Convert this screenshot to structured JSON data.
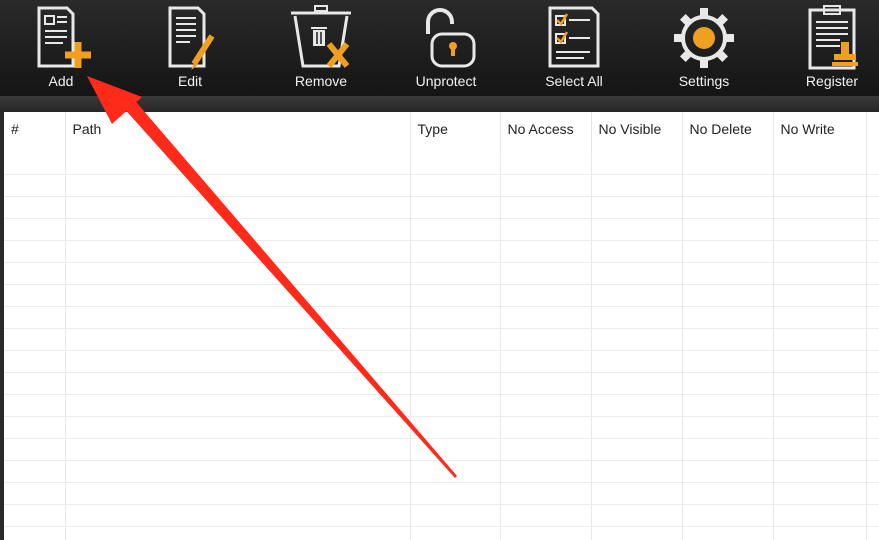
{
  "toolbar": {
    "buttons": [
      {
        "id": "add",
        "label": "Add",
        "icon": "add-document-icon"
      },
      {
        "id": "edit",
        "label": "Edit",
        "icon": "edit-document-icon"
      },
      {
        "id": "remove",
        "label": "Remove",
        "icon": "trash-remove-icon"
      },
      {
        "id": "unprotect",
        "label": "Unprotect",
        "icon": "unlock-icon"
      },
      {
        "id": "select_all",
        "label": "Select All",
        "icon": "checklist-icon"
      },
      {
        "id": "settings",
        "label": "Settings",
        "icon": "gear-icon"
      },
      {
        "id": "register",
        "label": "Register",
        "icon": "clipboard-stamp-icon"
      }
    ]
  },
  "table": {
    "columns": [
      "#",
      "Path",
      "Type",
      "No Access",
      "No Visible",
      "No Delete",
      "No Write"
    ]
  },
  "annotation": {
    "arrow_icon": "red-arrow-icon",
    "color": "#ff2a1a"
  },
  "colors": {
    "accent": "#f0a020",
    "toolbar_bg": "#1e1e1e",
    "icon_stroke": "#e8e8e8"
  }
}
